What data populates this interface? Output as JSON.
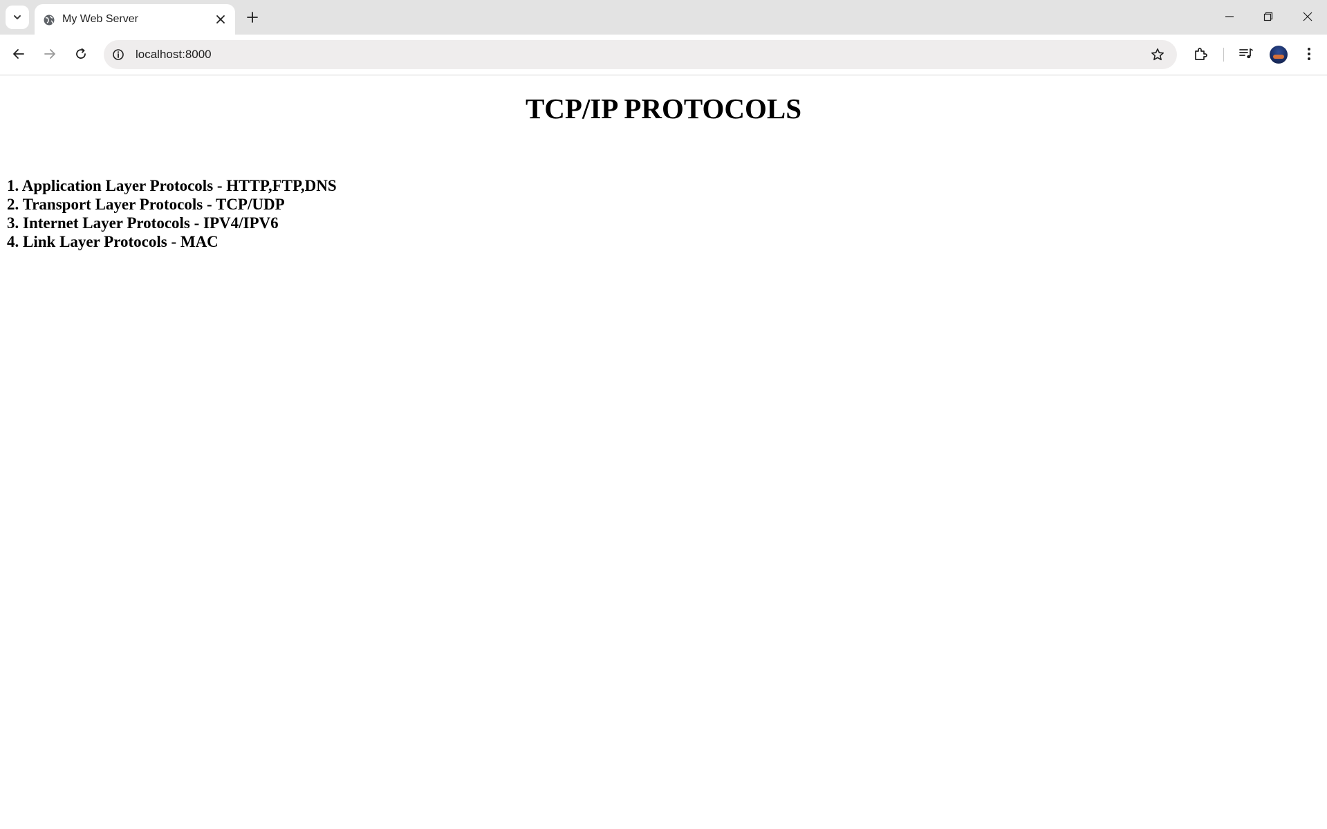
{
  "browser": {
    "tab": {
      "title": "My Web Server",
      "favicon_icon": "globe-icon"
    },
    "address_bar": {
      "url": "localhost:8000"
    },
    "icons": {
      "tab_search": "chevron-down-icon",
      "tab_close": "close-icon",
      "new_tab": "plus-icon",
      "minimize": "minimize-icon",
      "restore": "restore-icon",
      "close_window": "close-icon",
      "back": "arrow-left-icon",
      "forward": "arrow-right-icon",
      "reload": "reload-icon",
      "site_info": "info-icon",
      "bookmark": "star-icon",
      "extensions": "puzzle-icon",
      "media": "media-queue-icon",
      "menu": "kebab-menu-icon"
    }
  },
  "page": {
    "title": "TCP/IP PROTOCOLS",
    "items": [
      "1. Application Layer Protocols - HTTP,FTP,DNS",
      "2. Transport Layer Protocols - TCP/UDP",
      "3. Internet Layer Protocols - IPV4/IPV6",
      "4. Link Layer Protocols - MAC"
    ]
  }
}
